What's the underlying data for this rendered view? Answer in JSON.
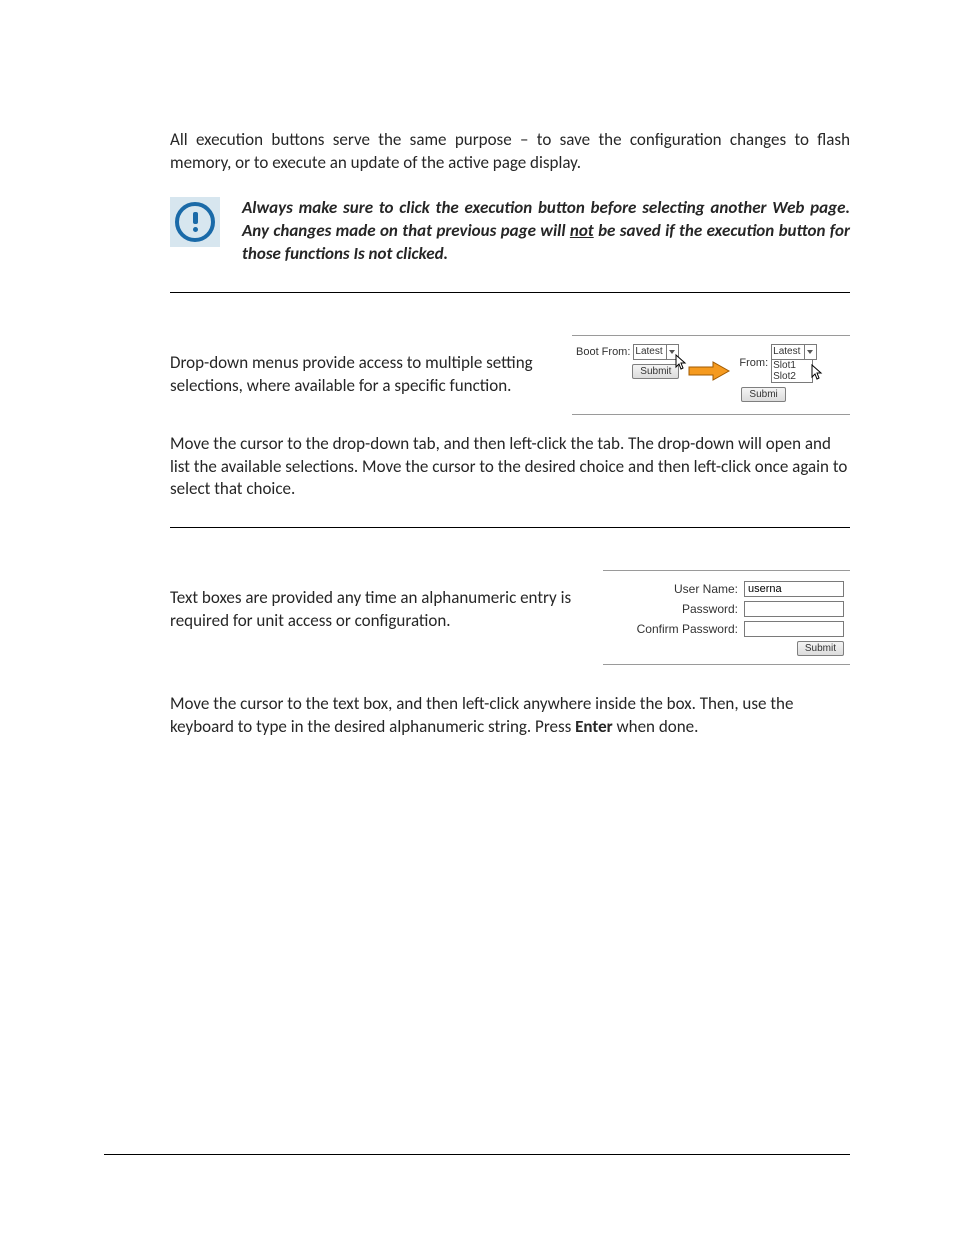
{
  "section1": {
    "para": "All execution buttons serve the same purpose – to save the configuration changes to flash memory, or to execute an update of the active page display.",
    "note_pre": "Always make sure to click the execution button before selecting another Web page. Any changes made on that previous page will ",
    "note_not": "not",
    "note_post": " be saved if the execution button for those functions Is not clicked."
  },
  "section2": {
    "intro": "Drop-down menus provide access to multiple setting selections, where available for a specific function.",
    "detail": "Move the cursor to the drop-down tab, and then left-click the tab. The drop-down will open and list the available selections. Move the cursor to the desired choice and then left-click once again to select that choice.",
    "fig": {
      "label_full": "Boot From:",
      "label_short": "From:",
      "option_latest": "Latest",
      "option_slot1": "Slot1",
      "option_slot2": "Slot2",
      "submit": "Submit",
      "submit_short": "Submi"
    }
  },
  "section3": {
    "intro": "Text boxes are provided any time an alphanumeric entry is required for unit access or configuration.",
    "detail_pre": "Move the cursor to the text box, and then left-click anywhere inside the box. Then, use the keyboard to type in the desired alphanumeric string. Press ",
    "detail_enter": "Enter",
    "detail_post": " when done.",
    "fig": {
      "username_label": "User Name:",
      "username_value": "userna",
      "password_label": "Password:",
      "confirm_label": "Confirm Password:",
      "submit": "Submit"
    }
  }
}
